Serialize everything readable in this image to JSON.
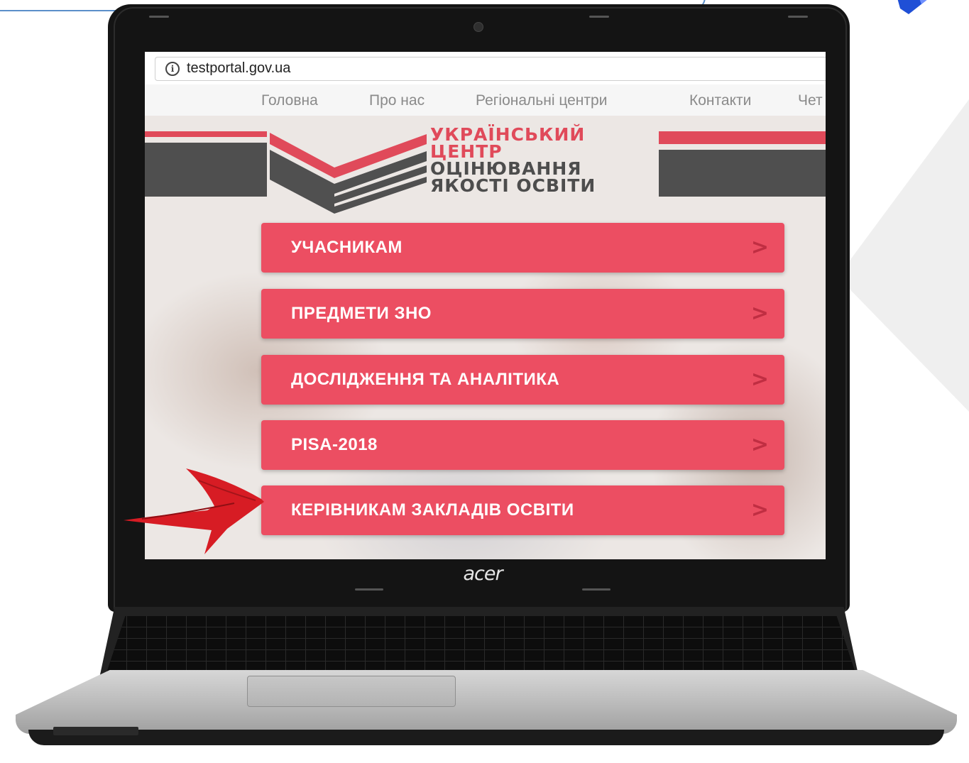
{
  "browser": {
    "url": "testportal.gov.ua"
  },
  "nav": {
    "items": [
      "Головна",
      "Про нас",
      "Регіональні центри",
      "Контакти",
      "Чет"
    ]
  },
  "logo": {
    "line1": "УКРАЇНСЬКИЙ",
    "line2": "ЦЕНТР",
    "line3": "ОЦІНЮВАННЯ",
    "line4": "ЯКОСТІ ОСВІТИ"
  },
  "menu": [
    {
      "label": "УЧАСНИКАМ",
      "arrow": ">"
    },
    {
      "label": "ПРЕДМЕТИ ЗНО",
      "arrow": ">"
    },
    {
      "label": "ДОСЛІДЖЕННЯ ТА АНАЛІТИКА",
      "arrow": ">"
    },
    {
      "label": "PISA-2018",
      "arrow": ">"
    },
    {
      "label": "КЕРІВНИКАМ ЗАКЛАДІВ ОСВІТИ",
      "arrow": ">"
    }
  ],
  "laptop": {
    "brand": "acer"
  },
  "colors": {
    "menu_button": "#ec4e62",
    "logo_red": "#e04a5a",
    "logo_gray": "#4d4d4d",
    "pointer_arrow": "#d71c24"
  },
  "icons": [
    "info-icon",
    "chevron-right-icon",
    "red-pointer-arrow-icon"
  ]
}
